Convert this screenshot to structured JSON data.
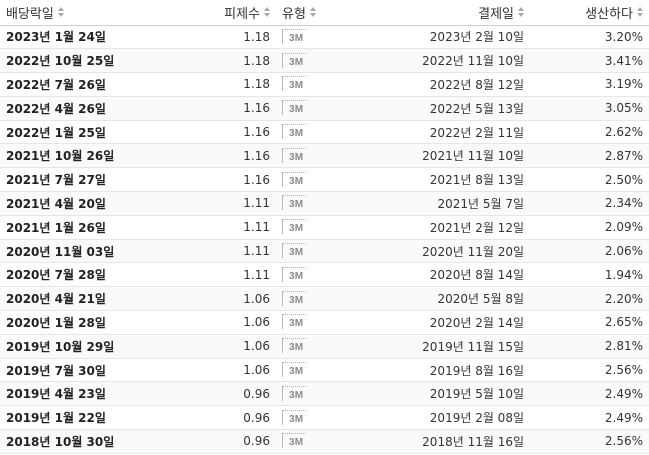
{
  "headers": {
    "ex_date": "배당락일",
    "amount": "피제수",
    "type": "유형",
    "pay_date": "결제일",
    "yield": "생산하다"
  },
  "rows": [
    {
      "ex_date": "2023년 1월 24일",
      "amount": "1.18",
      "type": "3M",
      "pay_date": "2023년 2월 10일",
      "yield": "3.20%"
    },
    {
      "ex_date": "2022년 10월 25일",
      "amount": "1.18",
      "type": "3M",
      "pay_date": "2022년 11월 10일",
      "yield": "3.41%"
    },
    {
      "ex_date": "2022년 7월 26일",
      "amount": "1.18",
      "type": "3M",
      "pay_date": "2022년 8월 12일",
      "yield": "3.19%"
    },
    {
      "ex_date": "2022년 4월 26일",
      "amount": "1.16",
      "type": "3M",
      "pay_date": "2022년 5월 13일",
      "yield": "3.05%"
    },
    {
      "ex_date": "2022년 1월 25일",
      "amount": "1.16",
      "type": "3M",
      "pay_date": "2022년 2월 11일",
      "yield": "2.62%"
    },
    {
      "ex_date": "2021년 10월 26일",
      "amount": "1.16",
      "type": "3M",
      "pay_date": "2021년 11월 10일",
      "yield": "2.87%"
    },
    {
      "ex_date": "2021년 7월 27일",
      "amount": "1.16",
      "type": "3M",
      "pay_date": "2021년 8월 13일",
      "yield": "2.50%"
    },
    {
      "ex_date": "2021년 4월 20일",
      "amount": "1.11",
      "type": "3M",
      "pay_date": "2021년 5월 7일",
      "yield": "2.34%"
    },
    {
      "ex_date": "2021년 1월 26일",
      "amount": "1.11",
      "type": "3M",
      "pay_date": "2021년 2월 12일",
      "yield": "2.09%"
    },
    {
      "ex_date": "2020년 11월 03일",
      "amount": "1.11",
      "type": "3M",
      "pay_date": "2020년 11월 20일",
      "yield": "2.06%"
    },
    {
      "ex_date": "2020년 7월 28일",
      "amount": "1.11",
      "type": "3M",
      "pay_date": "2020년 8월 14일",
      "yield": "1.94%"
    },
    {
      "ex_date": "2020년 4월 21일",
      "amount": "1.06",
      "type": "3M",
      "pay_date": "2020년 5월 8일",
      "yield": "2.20%"
    },
    {
      "ex_date": "2020년 1월 28일",
      "amount": "1.06",
      "type": "3M",
      "pay_date": "2020년 2월 14일",
      "yield": "2.65%"
    },
    {
      "ex_date": "2019년 10월 29일",
      "amount": "1.06",
      "type": "3M",
      "pay_date": "2019년 11월 15일",
      "yield": "2.81%"
    },
    {
      "ex_date": "2019년 7월 30일",
      "amount": "1.06",
      "type": "3M",
      "pay_date": "2019년 8월 16일",
      "yield": "2.56%"
    },
    {
      "ex_date": "2019년 4월 23일",
      "amount": "0.96",
      "type": "3M",
      "pay_date": "2019년 5월 10일",
      "yield": "2.49%"
    },
    {
      "ex_date": "2019년 1월 22일",
      "amount": "0.96",
      "type": "3M",
      "pay_date": "2019년 2월 08일",
      "yield": "2.49%"
    },
    {
      "ex_date": "2018년 10월 30일",
      "amount": "0.96",
      "type": "3M",
      "pay_date": "2018년 11월 16일",
      "yield": "2.56%"
    }
  ]
}
